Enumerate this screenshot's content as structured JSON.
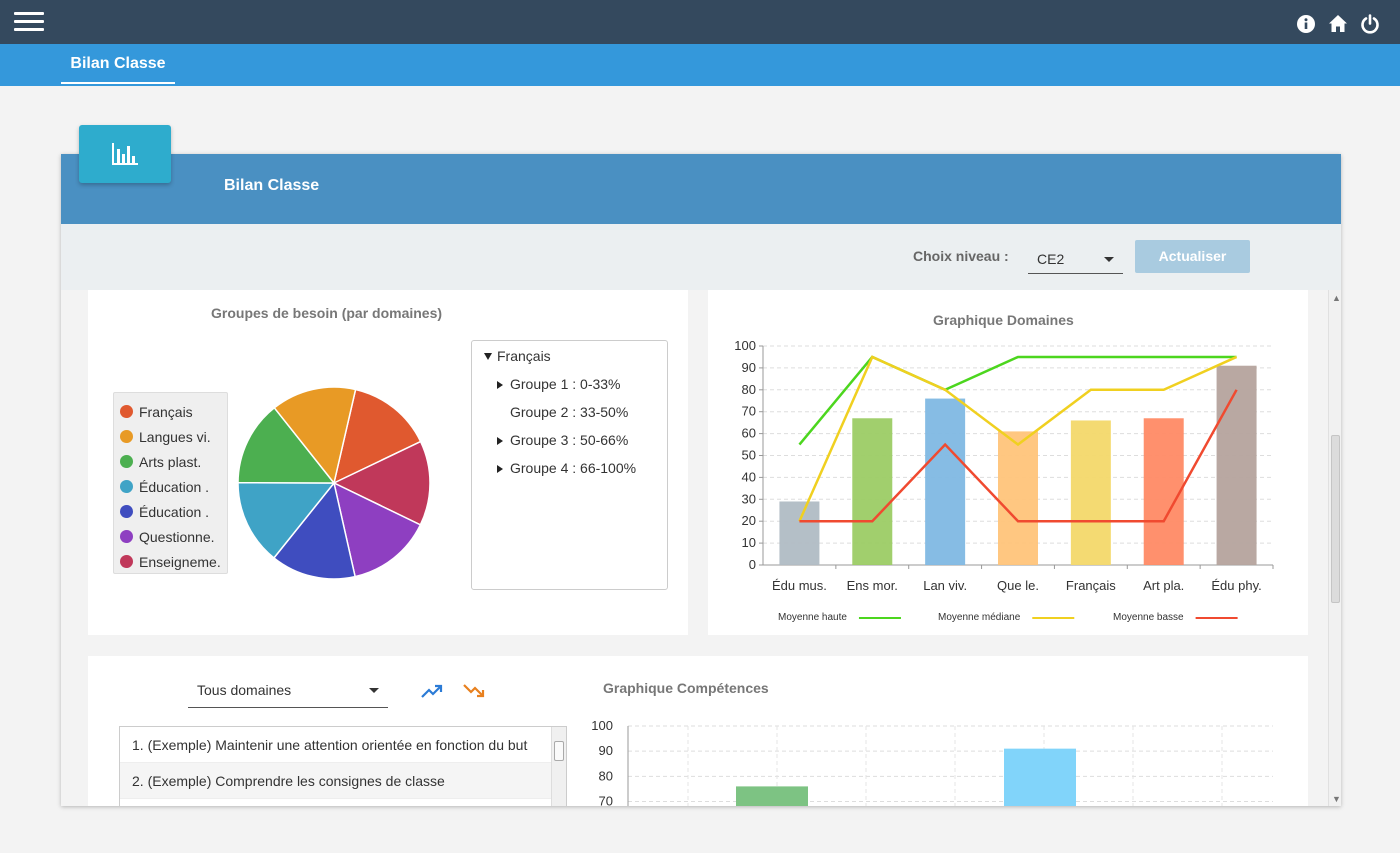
{
  "topbar": {
    "icons": [
      "menu-icon",
      "info-icon",
      "home-icon",
      "power-icon"
    ]
  },
  "subbar": {
    "tab_label": "Bilan Classe"
  },
  "card": {
    "title": "Bilan Classe",
    "badge_icon": "bar-chart-icon",
    "controls": {
      "choix_label": "Choix niveau :",
      "niveau_value": "CE2",
      "actualiser_label": "Actualiser"
    }
  },
  "groupes": {
    "title": "Groupes de besoin (par domaines)",
    "legend": [
      {
        "label": "Français",
        "color": "#e0592f"
      },
      {
        "label": "Langues vi.",
        "color": "#e89a25"
      },
      {
        "label": "Arts plast.",
        "color": "#4caf50"
      },
      {
        "label": "Éducation .",
        "color": "#3fa3c6"
      },
      {
        "label": "Éducation .",
        "color": "#3f4dbf"
      },
      {
        "label": "Questionne.",
        "color": "#8e3fc1"
      },
      {
        "label": "Enseigneme.",
        "color": "#c0385a"
      }
    ],
    "pie_colors": [
      "#e0592f",
      "#c0385a",
      "#8e3fc1",
      "#3f4dbf",
      "#3fa3c6",
      "#4caf50",
      "#e89a25"
    ],
    "tree": {
      "root": "Français",
      "items": [
        "Groupe 1 : 0-33%",
        "Groupe 2 : 33-50%",
        "Groupe 3 : 50-66%",
        "Groupe 4 : 66-100%"
      ]
    }
  },
  "chart_data": [
    {
      "type": "bar",
      "title": "Graphique Domaines",
      "categories": [
        "Édu mus.",
        "Ens mor.",
        "Lan viv.",
        "Que le.",
        "Français",
        "Art pla.",
        "Édu phy."
      ],
      "values": [
        29,
        67,
        76,
        61,
        66,
        67,
        91
      ],
      "bar_colors": [
        "#b0bcc4",
        "#9ccc65",
        "#7fb8e3",
        "#ffc47a",
        "#f3d86a",
        "#ff8a65",
        "#b5a39d"
      ],
      "ylim": [
        0,
        100
      ],
      "yticks": [
        0,
        10,
        20,
        30,
        40,
        50,
        60,
        70,
        80,
        90,
        100
      ],
      "grid": true,
      "lines": [
        {
          "name": "Moyenne haute",
          "color": "#4cd61e",
          "values": [
            55,
            95,
            80,
            95,
            95,
            95,
            95
          ]
        },
        {
          "name": "Moyenne médiane",
          "color": "#f0d020",
          "values": [
            20,
            95,
            80,
            55,
            80,
            80,
            95
          ]
        },
        {
          "name": "Moyenne basse",
          "color": "#f04a30",
          "values": [
            20,
            20,
            55,
            20,
            20,
            20,
            80
          ]
        }
      ],
      "legend_position": "bottom"
    },
    {
      "type": "bar",
      "title": "Graphique Compétences",
      "categories": [
        "",
        ""
      ],
      "values": [
        76,
        91
      ],
      "bar_colors": [
        "#7dc383",
        "#81d4fa"
      ],
      "ylim": [
        70,
        100
      ],
      "yticks": [
        70,
        80,
        90,
        100
      ],
      "grid": true
    }
  ],
  "competences": {
    "domain_select": "Tous domaines",
    "trend_icons": [
      "trending-up-icon",
      "trending-down-icon"
    ],
    "items": [
      "1. (Exemple) Maintenir une attention orientée en fonction du but",
      "2. (Exemple) Comprendre les consignes de classe"
    ]
  }
}
